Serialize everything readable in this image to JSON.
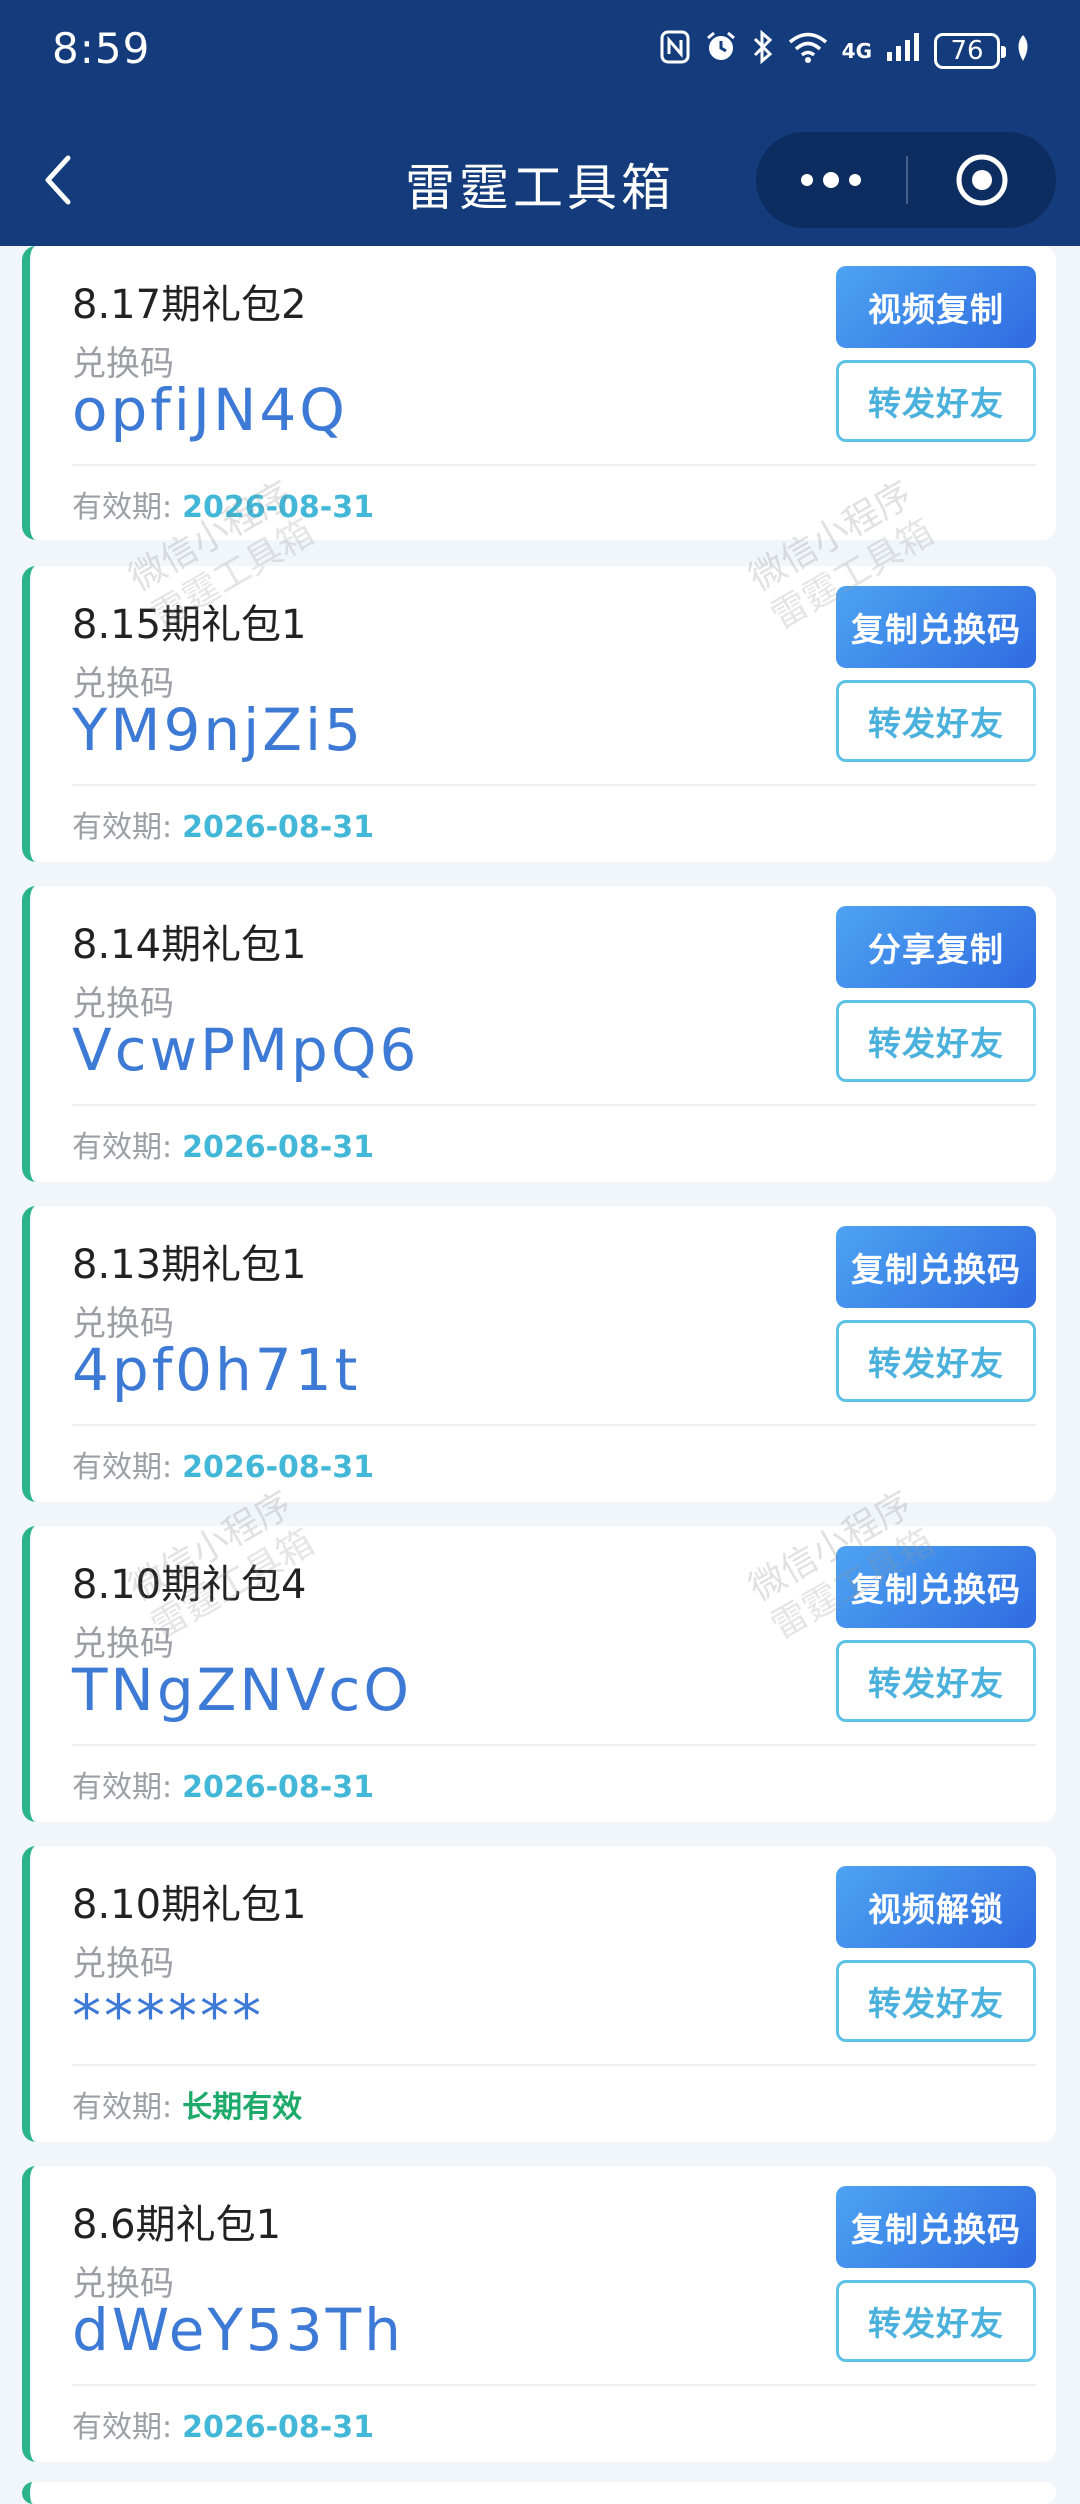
{
  "status_bar": {
    "time": "8:59",
    "network": "4G",
    "battery": "76"
  },
  "nav": {
    "title": "雷霆工具箱"
  },
  "watermark": {
    "line1": "微信小程序",
    "line2": "雷霆工具箱"
  },
  "labels": {
    "code_label": "兑换码",
    "expiry_label": "有效期:",
    "forward": "转发好友"
  },
  "cards": [
    {
      "title": "8.17期礼包2",
      "code": "opfiJN4Q",
      "action": "视频复制",
      "expiry": "2026-08-31"
    },
    {
      "title": "8.15期礼包1",
      "code": "YM9njZi5",
      "action": "复制兑换码",
      "expiry": "2026-08-31"
    },
    {
      "title": "8.14期礼包1",
      "code": "VcwPMpQ6",
      "action": "分享复制",
      "expiry": "2026-08-31"
    },
    {
      "title": "8.13期礼包1",
      "code": "4pf0h71t",
      "action": "复制兑换码",
      "expiry": "2026-08-31"
    },
    {
      "title": "8.10期礼包4",
      "code": "TNgZNVcO",
      "action": "复制兑换码",
      "expiry": "2026-08-31"
    },
    {
      "title": "8.10期礼包1",
      "code": "******",
      "action": "视频解锁",
      "expiry": "长期有效"
    },
    {
      "title": "8.6期礼包1",
      "code": "dWeY53Th",
      "action": "复制兑换码",
      "expiry": "2026-08-31"
    }
  ],
  "colors": {
    "header_bg": "#143c7c",
    "accent_green": "#2bb38a",
    "code_blue": "#3d7ad6",
    "date_blue": "#42b7d8",
    "date_green": "#1eaa6a"
  }
}
